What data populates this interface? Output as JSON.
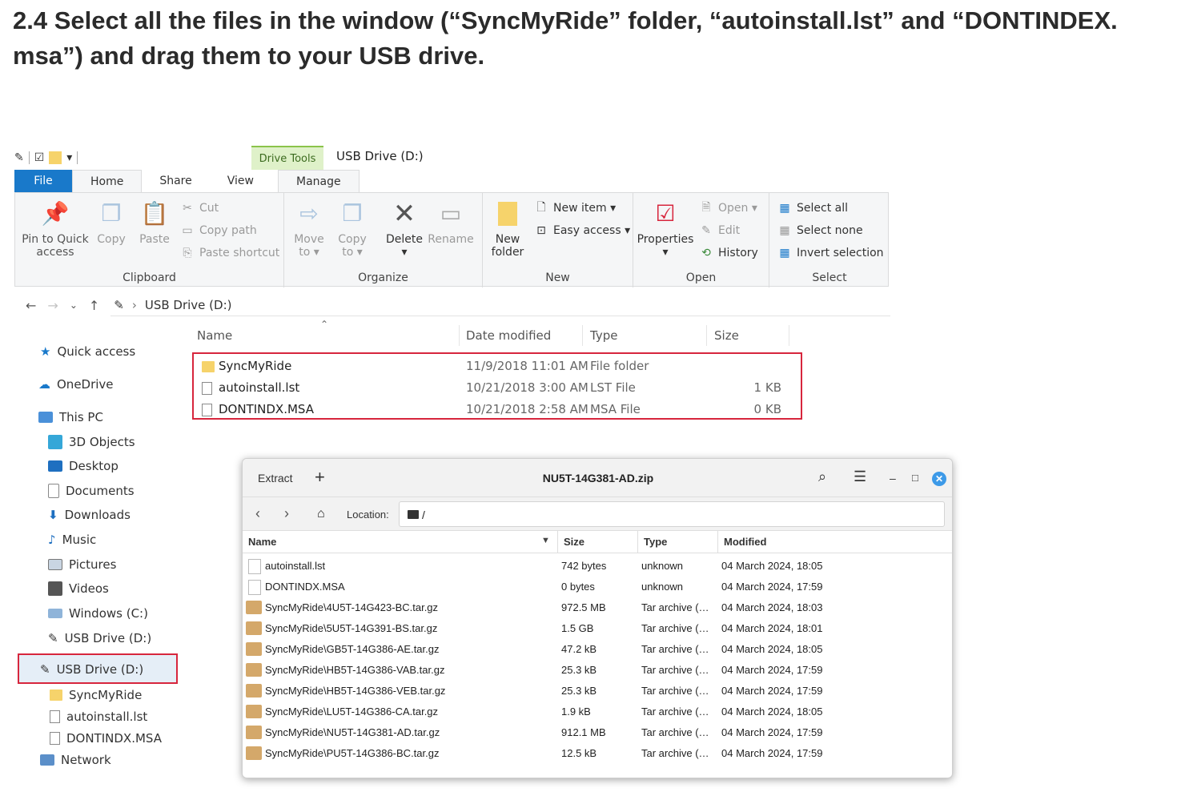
{
  "heading": {
    "line1": "2.4   Select all the files in the window (“SyncMyRide” folder, “autoinstall.lst” and “DONTINDEX.",
    "line2": "msa”) and drag them to your USB drive."
  },
  "explorer": {
    "context_tab": "Drive Tools",
    "title": "USB Drive (D:)",
    "tabs": [
      "File",
      "Home",
      "Share",
      "View",
      "Manage"
    ],
    "ribbon": {
      "clipboard": {
        "label": "Clipboard",
        "pin": "Pin to Quick",
        "pin2": "access",
        "copy": "Copy",
        "paste": "Paste",
        "cut": "Cut",
        "copy_path": "Copy path",
        "paste_shortcut": "Paste shortcut"
      },
      "organize": {
        "label": "Organize",
        "move": "Move",
        "move2": "to ▾",
        "copy": "Copy",
        "copy2": "to ▾",
        "delete": "Delete",
        "delete2": "▾",
        "rename": "Rename"
      },
      "new": {
        "label": "New",
        "new_folder": "New",
        "new_folder2": "folder",
        "new_item": "New item ▾",
        "easy_access": "Easy access ▾"
      },
      "open": {
        "label": "Open",
        "properties": "Properties",
        "properties2": "▾",
        "open": "Open ▾",
        "edit": "Edit",
        "history": "History"
      },
      "select": {
        "label": "Select",
        "select_all": "Select all",
        "select_none": "Select none",
        "invert": "Invert selection"
      }
    },
    "address": "USB Drive (D:)",
    "columns": [
      "Name",
      "Date modified",
      "Type",
      "Size"
    ],
    "files": [
      {
        "name": "SyncMyRide",
        "date": "11/9/2018 11:01 AM",
        "type": "File folder",
        "size": "",
        "kind": "folder"
      },
      {
        "name": "autoinstall.lst",
        "date": "10/21/2018 3:00 AM",
        "type": "LST File",
        "size": "1 KB",
        "kind": "file"
      },
      {
        "name": "DONTINDX.MSA",
        "date": "10/21/2018 2:58 AM",
        "type": "MSA File",
        "size": "0 KB",
        "kind": "file"
      }
    ],
    "nav": {
      "quick_access": "Quick access",
      "onedrive": "OneDrive",
      "this_pc": "This PC",
      "objects3d": "3D Objects",
      "desktop": "Desktop",
      "documents": "Documents",
      "downloads": "Downloads",
      "music": "Music",
      "pictures": "Pictures",
      "videos": "Videos",
      "windows": "Windows (C:)",
      "usb1": "USB Drive (D:)",
      "usb2": "USB Drive (D:)",
      "sub_sync": "SyncMyRide",
      "sub_auto": "autoinstall.lst",
      "sub_dont": "DONTINDX.MSA",
      "network": "Network"
    }
  },
  "archive": {
    "extract": "Extract",
    "title": "NU5T-14G381-AD.zip",
    "location_label": "Location:",
    "location": "/",
    "columns": [
      "Name",
      "Size",
      "Type",
      "Modified"
    ],
    "rows": [
      {
        "name": "autoinstall.lst",
        "size": "742 bytes",
        "type": "unknown",
        "modified": "04 March 2024, 18:05",
        "kind": "blank"
      },
      {
        "name": "DONTINDX.MSA",
        "size": "0 bytes",
        "type": "unknown",
        "modified": "04 March 2024, 17:59",
        "kind": "blank"
      },
      {
        "name": "SyncMyRide\\4U5T-14G423-BC.tar.gz",
        "size": "972.5 MB",
        "type": "Tar archive (…",
        "modified": "04 March 2024, 18:03",
        "kind": "tar"
      },
      {
        "name": "SyncMyRide\\5U5T-14G391-BS.tar.gz",
        "size": "1.5 GB",
        "type": "Tar archive (…",
        "modified": "04 March 2024, 18:01",
        "kind": "tar"
      },
      {
        "name": "SyncMyRide\\GB5T-14G386-AE.tar.gz",
        "size": "47.2 kB",
        "type": "Tar archive (…",
        "modified": "04 March 2024, 18:05",
        "kind": "tar"
      },
      {
        "name": "SyncMyRide\\HB5T-14G386-VAB.tar.gz",
        "size": "25.3 kB",
        "type": "Tar archive (…",
        "modified": "04 March 2024, 17:59",
        "kind": "tar"
      },
      {
        "name": "SyncMyRide\\HB5T-14G386-VEB.tar.gz",
        "size": "25.3 kB",
        "type": "Tar archive (…",
        "modified": "04 March 2024, 17:59",
        "kind": "tar"
      },
      {
        "name": "SyncMyRide\\LU5T-14G386-CA.tar.gz",
        "size": "1.9 kB",
        "type": "Tar archive (…",
        "modified": "04 March 2024, 18:05",
        "kind": "tar"
      },
      {
        "name": "SyncMyRide\\NU5T-14G381-AD.tar.gz",
        "size": "912.1 MB",
        "type": "Tar archive (…",
        "modified": "04 March 2024, 17:59",
        "kind": "tar"
      },
      {
        "name": "SyncMyRide\\PU5T-14G386-BC.tar.gz",
        "size": "12.5 kB",
        "type": "Tar archive (…",
        "modified": "04 March 2024, 17:59",
        "kind": "tar"
      }
    ]
  },
  "colors": {
    "file_tab": "#1979ca",
    "highlight_red": "#d7263d",
    "drive_tools": "#dff1c9",
    "folder_yellow": "#f6d36b",
    "tar_brown": "#d4a86a",
    "close_blue": "#3d9ae8"
  }
}
